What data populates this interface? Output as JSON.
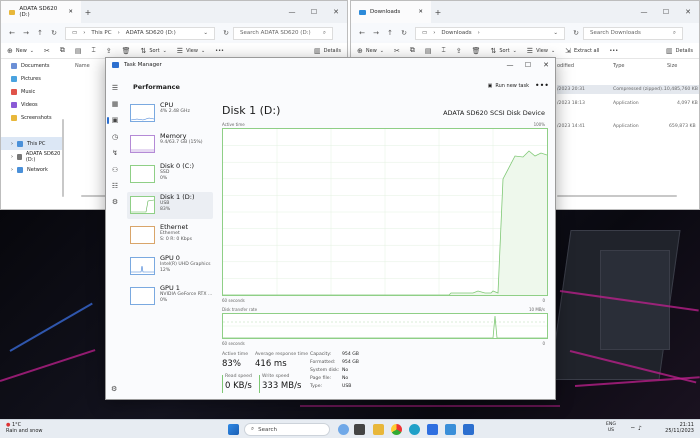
{
  "explorer_left": {
    "tab_title": "ADATA SD620 (D:)",
    "breadcrumb": [
      "This PC",
      "ADATA SD620 (D:)"
    ],
    "search_placeholder": "Search ADATA SD620 (D:)",
    "new_label": "New",
    "sort_label": "Sort",
    "view_label": "View",
    "details_label": "Details",
    "more_label": "•••",
    "column_name": "Name",
    "nav_items": [
      {
        "label": "Documents",
        "color": "#6b8fd6"
      },
      {
        "label": "Pictures",
        "color": "#4aa3e0"
      },
      {
        "label": "Music",
        "color": "#e0534a"
      },
      {
        "label": "Videos",
        "color": "#8a5ad6"
      },
      {
        "label": "Screenshots",
        "color": "#e8b73a"
      },
      {
        "label": "This PC",
        "color": "#4a90d9"
      },
      {
        "label": "ADATA SD620 (D:)",
        "color": "#777777"
      },
      {
        "label": "Network",
        "color": "#4a90d9"
      }
    ]
  },
  "explorer_right": {
    "tab_title": "Downloads",
    "breadcrumb": [
      "Downloads"
    ],
    "search_placeholder": "Search Downloads",
    "new_label": "New",
    "sort_label": "Sort",
    "view_label": "View",
    "extract_label": "Extract all",
    "details_label": "Details",
    "more_label": "•••",
    "columns": [
      "odified",
      "Type",
      "Size"
    ],
    "rows": [
      {
        "modified": "/2023 20:31",
        "type": "Compressed (zipped)...",
        "size": "10,485,760 KB"
      },
      {
        "modified": "/2023 18:13",
        "type": "Application",
        "size": "4,097 KB"
      },
      {
        "modified": "/2023 14:41",
        "type": "Application",
        "size": "659,873 KB"
      }
    ]
  },
  "taskmgr": {
    "title": "Task Manager",
    "section": "Performance",
    "run_new_task": "Run new task",
    "more": "•••",
    "devices": [
      {
        "name": "CPU",
        "sub1": "4%  2.48 GHz",
        "sub2": ""
      },
      {
        "name": "Memory",
        "sub1": "9.4/63.7 GB (15%)",
        "sub2": ""
      },
      {
        "name": "Disk 0 (C:)",
        "sub1": "SSD",
        "sub2": "0%"
      },
      {
        "name": "Disk 1 (D:)",
        "sub1": "USB",
        "sub2": "83%"
      },
      {
        "name": "Ethernet",
        "sub1": "Ethernet",
        "sub2": "S: 0  R: 0 Kbps"
      },
      {
        "name": "GPU 0",
        "sub1": "Intel(R) UHD Graphics",
        "sub2": "12%"
      },
      {
        "name": "GPU 1",
        "sub1": "NVIDIA GeForce RTX ...",
        "sub2": "0%"
      }
    ],
    "detail": {
      "title": "Disk 1 (D:)",
      "model": "ADATA SD620 SCSI Disk Device",
      "active_time_label": "Active time",
      "active_time_max": "100%",
      "graph1_left": "60 seconds",
      "graph1_right": "0",
      "transfer_label": "Disk transfer rate",
      "transfer_max": "10 MB/s",
      "transfer_marker": "7 MB/s",
      "graph2_left": "60 seconds",
      "graph2_right": "0",
      "active_time_percent": 83,
      "response_time": "416 ms",
      "read_speed": "0 KB/s",
      "write_speed": "333 MB/s",
      "labels": {
        "active_time": "Active time",
        "avg_response": "Average response time",
        "read_speed": "Read speed",
        "write_speed": "Write speed"
      },
      "active_time_value": "83%",
      "props": [
        {
          "key": "Capacity:",
          "value": "954 GB"
        },
        {
          "key": "Formatted:",
          "value": "954 GB"
        },
        {
          "key": "System disk:",
          "value": "No"
        },
        {
          "key": "Page file:",
          "value": "No"
        },
        {
          "key": "Type:",
          "value": "USB"
        }
      ]
    }
  },
  "taskbar": {
    "weather_temp": "1°C",
    "weather_desc": "Rain and snow",
    "search_label": "Search",
    "lang_1": "ENG",
    "lang_2": "US",
    "time": "21:11",
    "date": "25/11/2023"
  }
}
